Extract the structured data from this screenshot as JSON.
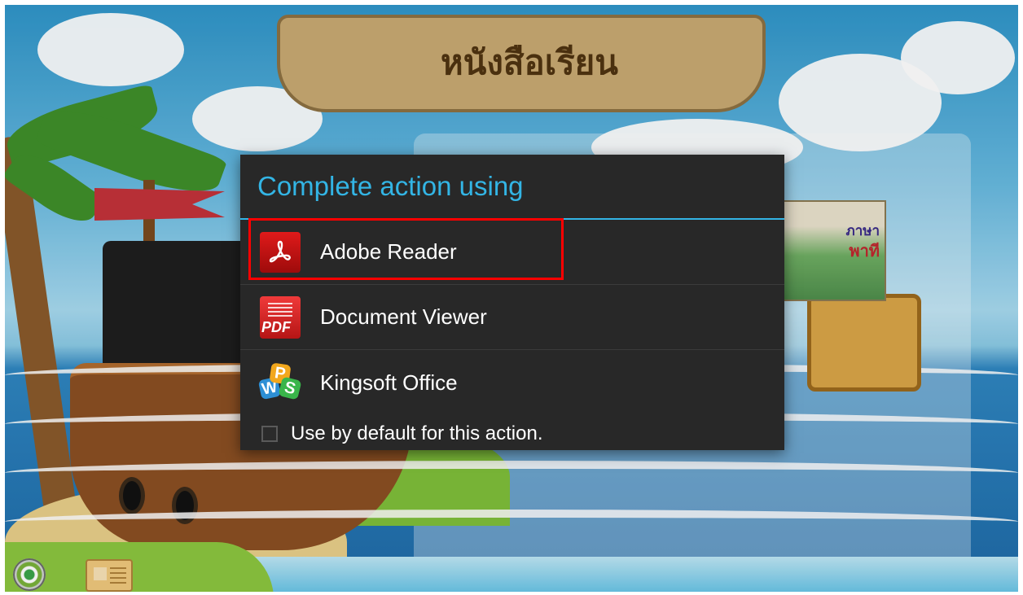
{
  "background": {
    "banner_title": "หนังสือเรียน",
    "book_cover_title": "ภาษา",
    "book_cover_subtitle": "พาที"
  },
  "dialog": {
    "title": "Complete action using",
    "options": [
      {
        "label": "Adobe Reader",
        "icon": "adobe-reader-icon",
        "highlighted": true
      },
      {
        "label": "Document Viewer",
        "icon": "pdf-document-icon",
        "badge": "PDF"
      },
      {
        "label": "Kingsoft Office",
        "icon": "wps-office-icon",
        "letters": [
          "W",
          "P",
          "S"
        ]
      }
    ],
    "default_checkbox_label": "Use by default for this action.",
    "default_checked": false
  },
  "toolbar": {
    "settings_icon": "gear-icon",
    "book_icon": "book-icon"
  },
  "colors": {
    "accent": "#33b5e5",
    "dialog_bg": "#282828",
    "highlight": "#ff0000"
  }
}
